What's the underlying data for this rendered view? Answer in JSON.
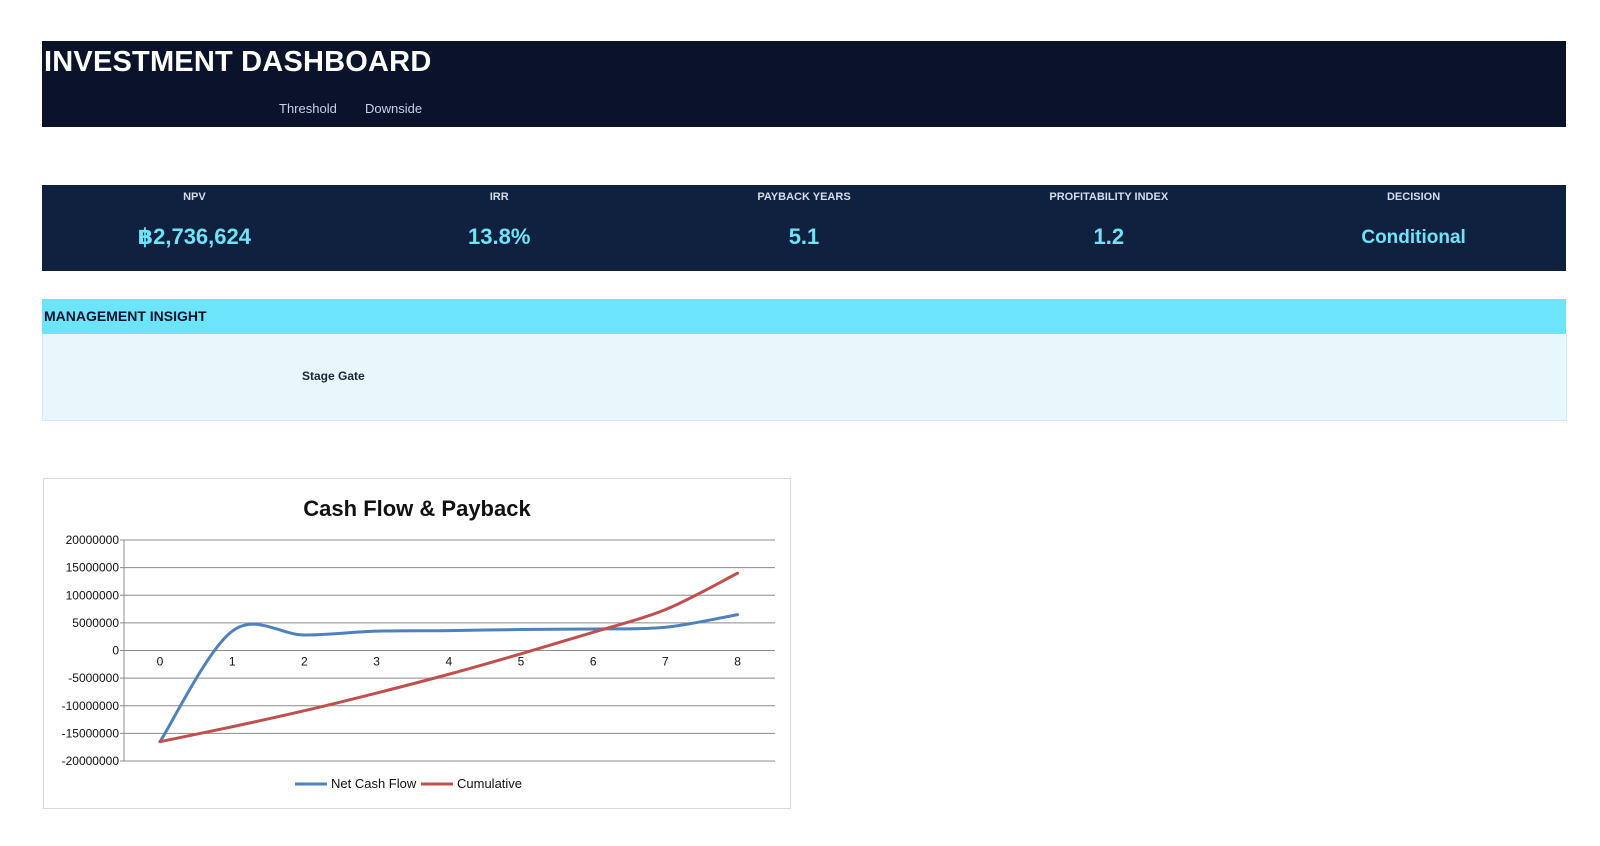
{
  "header": {
    "title": "INVESTMENT DASHBOARD",
    "links": [
      "Threshold",
      "Downside"
    ],
    "background": "#0b132b"
  },
  "kpis": [
    {
      "label": "NPV",
      "value": "฿2,736,624"
    },
    {
      "label": "IRR",
      "value": "13.8%"
    },
    {
      "label": "PAYBACK YEARS",
      "value": "5.1"
    },
    {
      "label": "PROFITABILITY INDEX",
      "value": "1.2"
    },
    {
      "label": "DECISION",
      "value": "Conditional"
    }
  ],
  "kpi_value_color": "#6ee4f7",
  "insight": {
    "title": "MANAGEMENT INSIGHT",
    "text": "Stage Gate",
    "header_color": "#6ce5fb",
    "body_color": "#e8f7fb"
  },
  "chart_data": {
    "type": "line",
    "title": "Cash Flow & Payback",
    "x": [
      0,
      1,
      2,
      3,
      4,
      5,
      6,
      7,
      8
    ],
    "ylim": [
      -20000000,
      20000000
    ],
    "yticks": [
      20000000,
      15000000,
      10000000,
      5000000,
      0,
      -5000000,
      -10000000,
      -15000000,
      -20000000
    ],
    "ytick_labels": [
      "20000000",
      "15000000",
      "10000000",
      "5000000",
      "0",
      "-5000000",
      "-10000000",
      "-15000000",
      "-20000000"
    ],
    "smooth": true,
    "grid": true,
    "legend": "bottom",
    "series": [
      {
        "name": "Net Cash Flow",
        "color": "#4f81bd",
        "values": [
          -16500000,
          3500000,
          2800000,
          3500000,
          3600000,
          3800000,
          3900000,
          4200000,
          6500000
        ]
      },
      {
        "name": "Cumulative",
        "color": "#c0504d",
        "values": [
          -16500000,
          -13800000,
          -10900000,
          -7700000,
          -4300000,
          -600000,
          3300000,
          7400000,
          14000000
        ]
      }
    ]
  }
}
